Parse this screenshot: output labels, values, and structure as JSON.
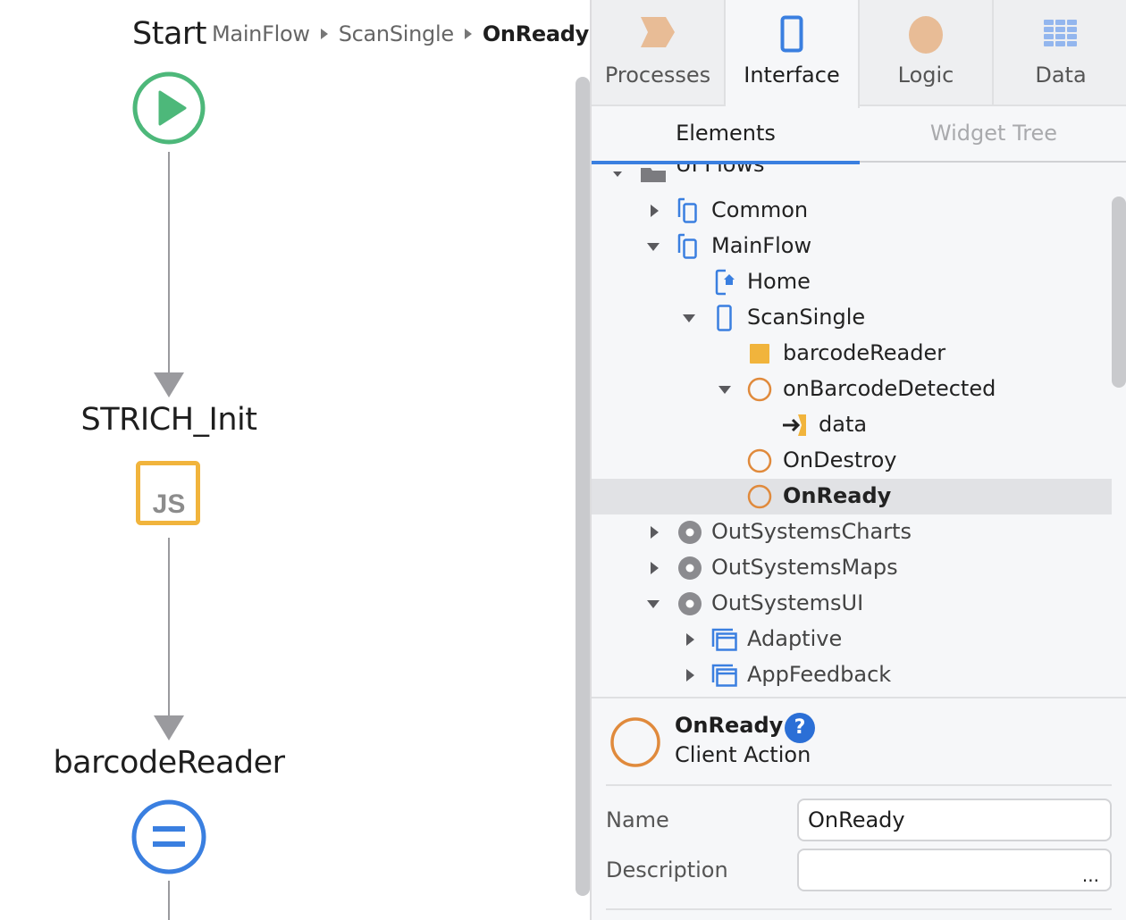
{
  "canvas": {
    "flow_title": "Start",
    "breadcrumb": [
      "MainFlow",
      "ScanSingle",
      "OnReady"
    ],
    "nodes": [
      {
        "type": "start",
        "icon": "play-circle-icon",
        "label": "Start"
      },
      {
        "type": "javascript",
        "icon": "js-icon",
        "label": "STRICH_Init",
        "icon_text": "JS"
      },
      {
        "type": "assign",
        "icon": "assign-icon",
        "label": "barcodeReader"
      }
    ],
    "colors": {
      "start": "#4db87a",
      "javascript": "#f1b43c",
      "assign": "#3a7fe0",
      "connector": "#9a9a9e"
    }
  },
  "panel": {
    "top_tabs": [
      {
        "label": "Processes",
        "icon": "processes-chevron-icon",
        "active": false
      },
      {
        "label": "Interface",
        "icon": "interface-phone-icon",
        "active": true
      },
      {
        "label": "Logic",
        "icon": "logic-circle-icon",
        "active": false
      },
      {
        "label": "Data",
        "icon": "data-grid-icon",
        "active": false
      }
    ],
    "sub_tabs": [
      {
        "label": "Elements",
        "active": true
      },
      {
        "label": "Widget Tree",
        "active": false
      }
    ],
    "tree": [
      {
        "label": "UI Flows",
        "icon": "folder-icon",
        "expanded": true,
        "level": 0,
        "partially_visible": true
      },
      {
        "label": "Common",
        "icon": "ui-flow-icon",
        "expanded": false,
        "level": 1
      },
      {
        "label": "MainFlow",
        "icon": "ui-flow-icon",
        "expanded": true,
        "level": 1
      },
      {
        "label": "Home",
        "icon": "home-screen-icon",
        "level": 2
      },
      {
        "label": "ScanSingle",
        "icon": "screen-icon",
        "expanded": true,
        "level": 2
      },
      {
        "label": "barcodeReader",
        "icon": "local-variable-icon",
        "level": 3
      },
      {
        "label": "onBarcodeDetected",
        "icon": "client-action-icon",
        "expanded": true,
        "level": 3
      },
      {
        "label": "data",
        "icon": "input-parameter-icon",
        "level": 4
      },
      {
        "label": "OnDestroy",
        "icon": "client-action-icon",
        "level": 3
      },
      {
        "label": "OnReady",
        "icon": "client-action-icon",
        "level": 3,
        "selected": true
      },
      {
        "label": "OutSystemsCharts",
        "icon": "module-icon",
        "expanded": false,
        "level": 1
      },
      {
        "label": "OutSystemsMaps",
        "icon": "module-icon",
        "expanded": false,
        "level": 1
      },
      {
        "label": "OutSystemsUI",
        "icon": "module-icon",
        "expanded": true,
        "level": 1
      },
      {
        "label": "Adaptive",
        "icon": "block-folder-icon",
        "expanded": false,
        "level": 2
      },
      {
        "label": "AppFeedback",
        "icon": "block-folder-icon",
        "expanded": false,
        "level": 2
      }
    ],
    "properties": {
      "title": "OnReady",
      "subtitle": "Client Action",
      "help_label": "?",
      "fields": [
        {
          "label": "Name",
          "value": "OnReady"
        },
        {
          "label": "Description",
          "value": "",
          "ellipsis": "..."
        }
      ]
    }
  }
}
